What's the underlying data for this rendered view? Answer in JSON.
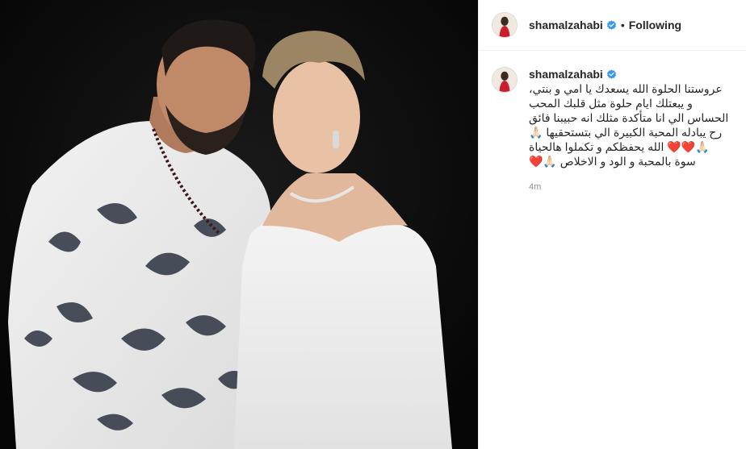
{
  "post": {
    "username": "shamalzahabi",
    "follow_state": "Following",
    "separator": "•",
    "caption": "عروستنا الحلوة الله يسعدك يا امي و بنتي، و يبعتلك ايام حلوة مثل قلبك المحب الحساس الي انا متأكدة مثلك انه حبيبنا فائق رح يبادله المحبة الكبيرة الي بتستحقيها 🙏🏻🙏🏻❤️❤️ الله يحفظكم و تكملوا هالحياة سوة بالمحبة و الود و الاخلاص 🙏🏻❤️",
    "time_ago": "4m"
  },
  "icons": {
    "verified": "verified-badge-icon",
    "avatar": "profile-avatar"
  },
  "colors": {
    "verified_blue": "#3897f0",
    "border": "#efefef",
    "secondary_text": "#8e8e8e"
  }
}
